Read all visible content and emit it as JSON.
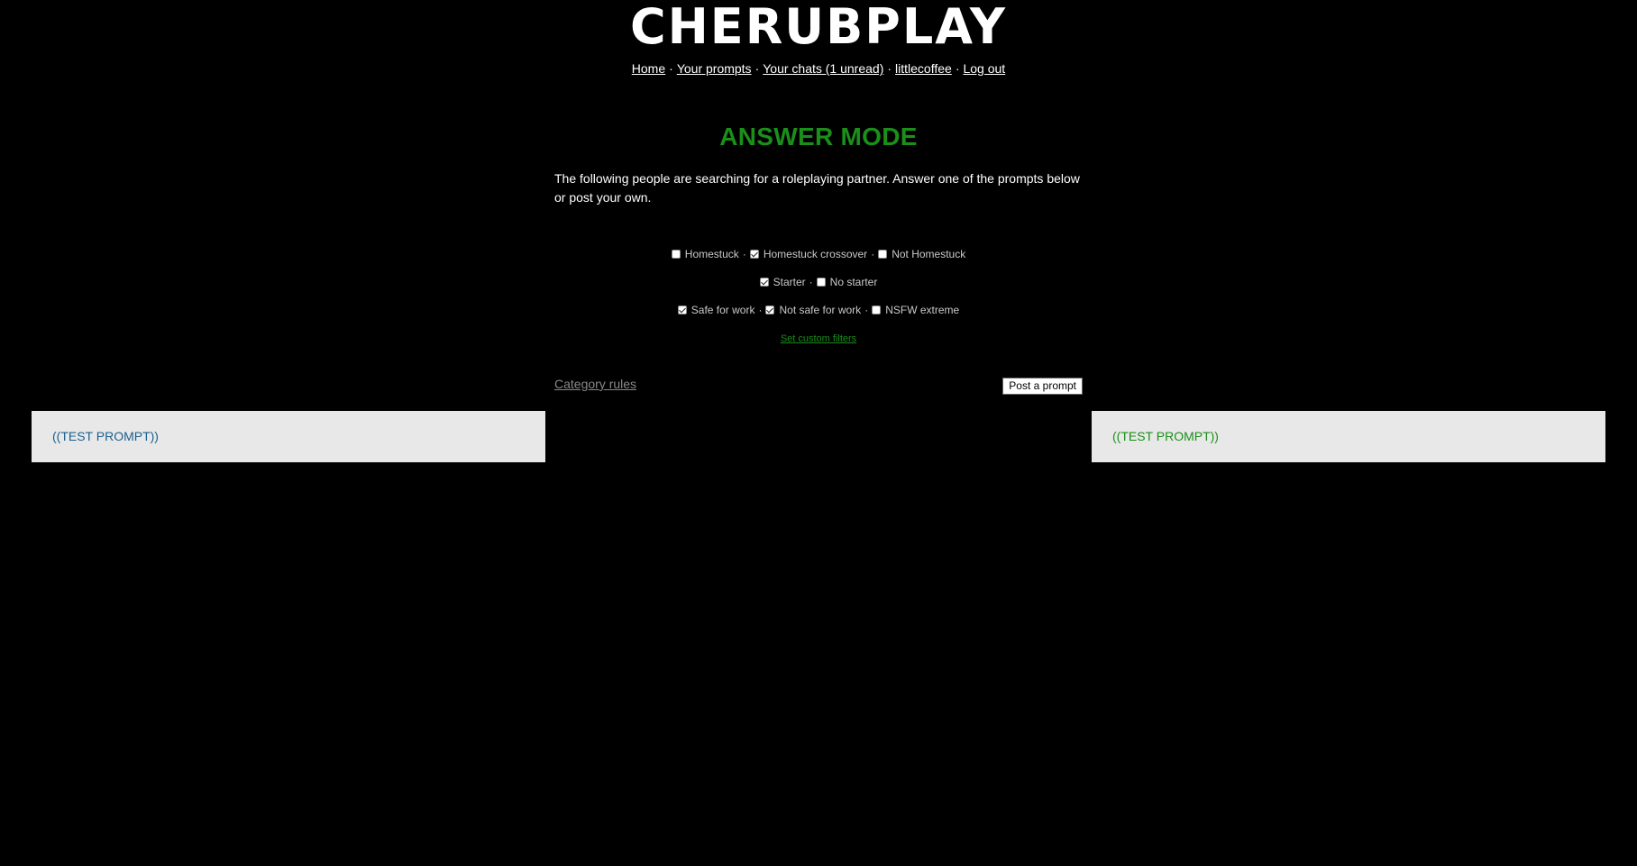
{
  "site": {
    "logo_text": "CHERUBPLAY"
  },
  "nav": {
    "items": [
      "Home",
      "Your prompts",
      "Your chats (1 unread)",
      "littlecoffee",
      "Log out"
    ],
    "separator": "·"
  },
  "main": {
    "title": "ANSWER MODE",
    "intro": "The following people are searching for a roleplaying partner. Answer one of the prompts below or post your own."
  },
  "filters": {
    "rows": [
      [
        {
          "label": "Homestuck",
          "checked": false
        },
        {
          "label": "Homestuck crossover",
          "checked": true
        },
        {
          "label": "Not Homestuck",
          "checked": false
        }
      ],
      [
        {
          "label": "Starter",
          "checked": true
        },
        {
          "label": "No starter",
          "checked": false
        }
      ],
      [
        {
          "label": "Safe for work",
          "checked": true
        },
        {
          "label": "Not safe for work",
          "checked": true
        },
        {
          "label": "NSFW extreme",
          "checked": false
        }
      ]
    ],
    "custom_link": "Set custom filters"
  },
  "actions": {
    "category_rules": "Category rules",
    "post_prompt": "Post a prompt"
  },
  "prompts": [
    {
      "text": "((TEST PROMPT))",
      "color": "#1a5f8f"
    },
    {
      "text": "((TEST PROMPT))",
      "color": "#1a8f1a"
    }
  ],
  "colors": {
    "background": "#000000",
    "accent_green": "#1a8f1a",
    "prompt_blue": "#1a5f8f",
    "card_bg": "#e8e8e8"
  }
}
